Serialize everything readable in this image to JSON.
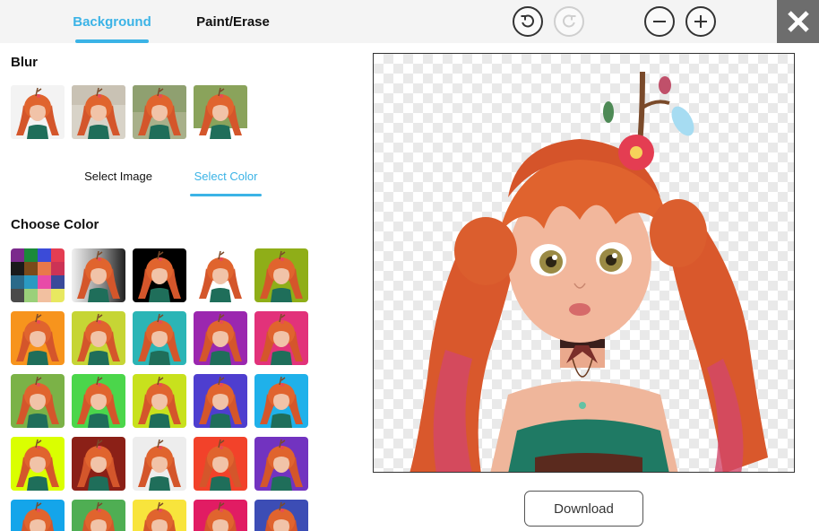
{
  "tabs": [
    {
      "label": "Background",
      "active": true
    },
    {
      "label": "Paint/Erase",
      "active": false
    }
  ],
  "toolbar": {
    "undo_icon": "undo-icon",
    "redo_icon": "redo-icon",
    "zoom_out_icon": "zoom-out-icon",
    "zoom_in_icon": "zoom-in-icon",
    "close_icon": "close-icon"
  },
  "blur": {
    "title": "Blur",
    "levels": 4
  },
  "subtabs": [
    {
      "label": "Select Image",
      "active": false
    },
    {
      "label": "Select Color",
      "active": true
    }
  ],
  "colors": {
    "title": "Choose Color",
    "swatches": [
      "palette",
      "gradient-gray",
      "#000000",
      "transparent",
      "#8fae18",
      "#f7941d",
      "#c6d535",
      "#2bb5b6",
      "#9b27af",
      "#e2327a",
      "#7bb247",
      "#4bd64b",
      "#c8e11d",
      "#4e3ecf",
      "#1fb1ea",
      "#daff00",
      "#8b2017",
      "#ededed",
      "#f2422a",
      "#7233c0",
      "#14a5ea",
      "#4fae53",
      "#f8e43c",
      "#e11c63",
      "#3c4db5"
    ]
  },
  "canvas": {
    "background": "transparent-checkerboard"
  },
  "download_label": "Download",
  "accent_color": "#3bb3e6"
}
